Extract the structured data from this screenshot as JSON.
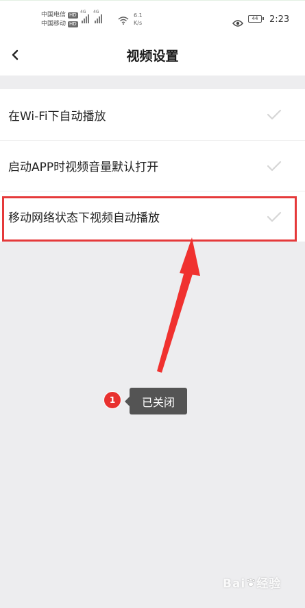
{
  "status_bar": {
    "carrier_1": "中国电信",
    "carrier_2": "中国移动",
    "hd_badge": "HD",
    "network_tag": "4G",
    "speed_value": "6.1",
    "speed_unit": "K/s",
    "battery_level": "44",
    "time": "2:23",
    "icons": [
      "signal-icon",
      "wifi-icon",
      "eye-icon",
      "battery-icon"
    ]
  },
  "header": {
    "title": "视频设置",
    "back_icon": "chevron-left-icon"
  },
  "settings": [
    {
      "label": "在Wi-Fi下自动播放",
      "checked": true
    },
    {
      "label": "启动APP时视频音量默认打开",
      "checked": true
    },
    {
      "label": "移动网络状态下视频自动播放",
      "checked": true
    }
  ],
  "annotation": {
    "step_number": "1",
    "tooltip_text": "已关闭",
    "highlight_color": "#e5393a",
    "arrow_color": "#f0312f"
  },
  "watermark": {
    "brand_left": "Bai",
    "brand_right": "经验"
  },
  "colors": {
    "background": "#ededef",
    "surface": "#ffffff",
    "check_inactive": "#d6d6d6",
    "tooltip_bg": "#545454"
  }
}
